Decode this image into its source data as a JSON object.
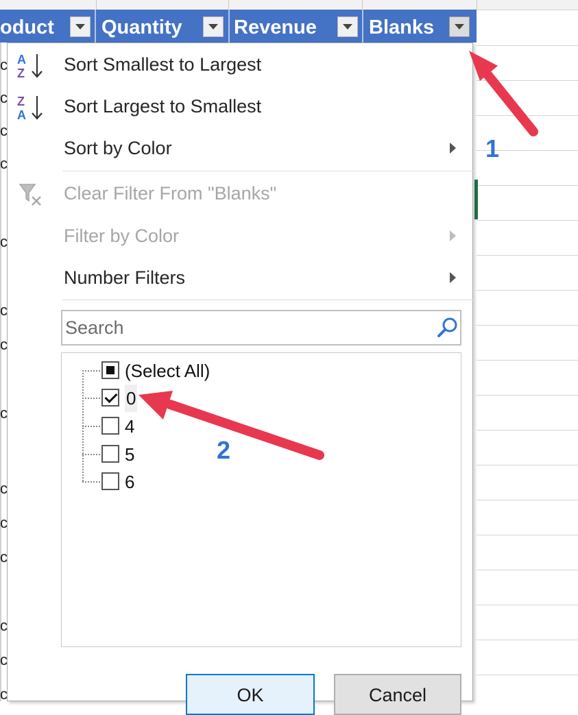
{
  "headers": [
    {
      "label": "oduct"
    },
    {
      "label": "Quantity"
    },
    {
      "label": "Revenue"
    },
    {
      "label": "Blanks"
    }
  ],
  "left_column_sliver": [
    "c",
    "c",
    "c",
    "c",
    "c",
    "c",
    "c",
    "c",
    "c",
    "c",
    "c",
    "c",
    "c",
    "c"
  ],
  "menu": {
    "sort_asc": {
      "label": "Sort Smallest to Largest",
      "icon": "sort-ascending-icon"
    },
    "sort_desc": {
      "label": "Sort Largest to Smallest",
      "icon": "sort-descending-icon"
    },
    "sort_color": {
      "label": "Sort by Color",
      "has_submenu": true
    },
    "clear_filter": {
      "label": "Clear Filter From \"Blanks\"",
      "icon": "clear-filter-icon",
      "disabled": true
    },
    "filter_color": {
      "label": "Filter by Color",
      "has_submenu": true,
      "disabled": true
    },
    "number_filters": {
      "label": "Number Filters",
      "has_submenu": true
    }
  },
  "search": {
    "placeholder": "Search",
    "icon": "search-icon"
  },
  "list": [
    {
      "label": "(Select All)",
      "state": "partial"
    },
    {
      "label": "0",
      "state": "checked"
    },
    {
      "label": "4",
      "state": "unchecked"
    },
    {
      "label": "5",
      "state": "unchecked"
    },
    {
      "label": "6",
      "state": "unchecked"
    }
  ],
  "buttons": {
    "ok": "OK",
    "cancel": "Cancel"
  },
  "annotations": {
    "step1": "1",
    "step2": "2",
    "arrow_color": "#e8384f",
    "number_color": "#2e74d6"
  },
  "colors": {
    "header_bg": "#4472c4",
    "accent_green": "#217346"
  }
}
